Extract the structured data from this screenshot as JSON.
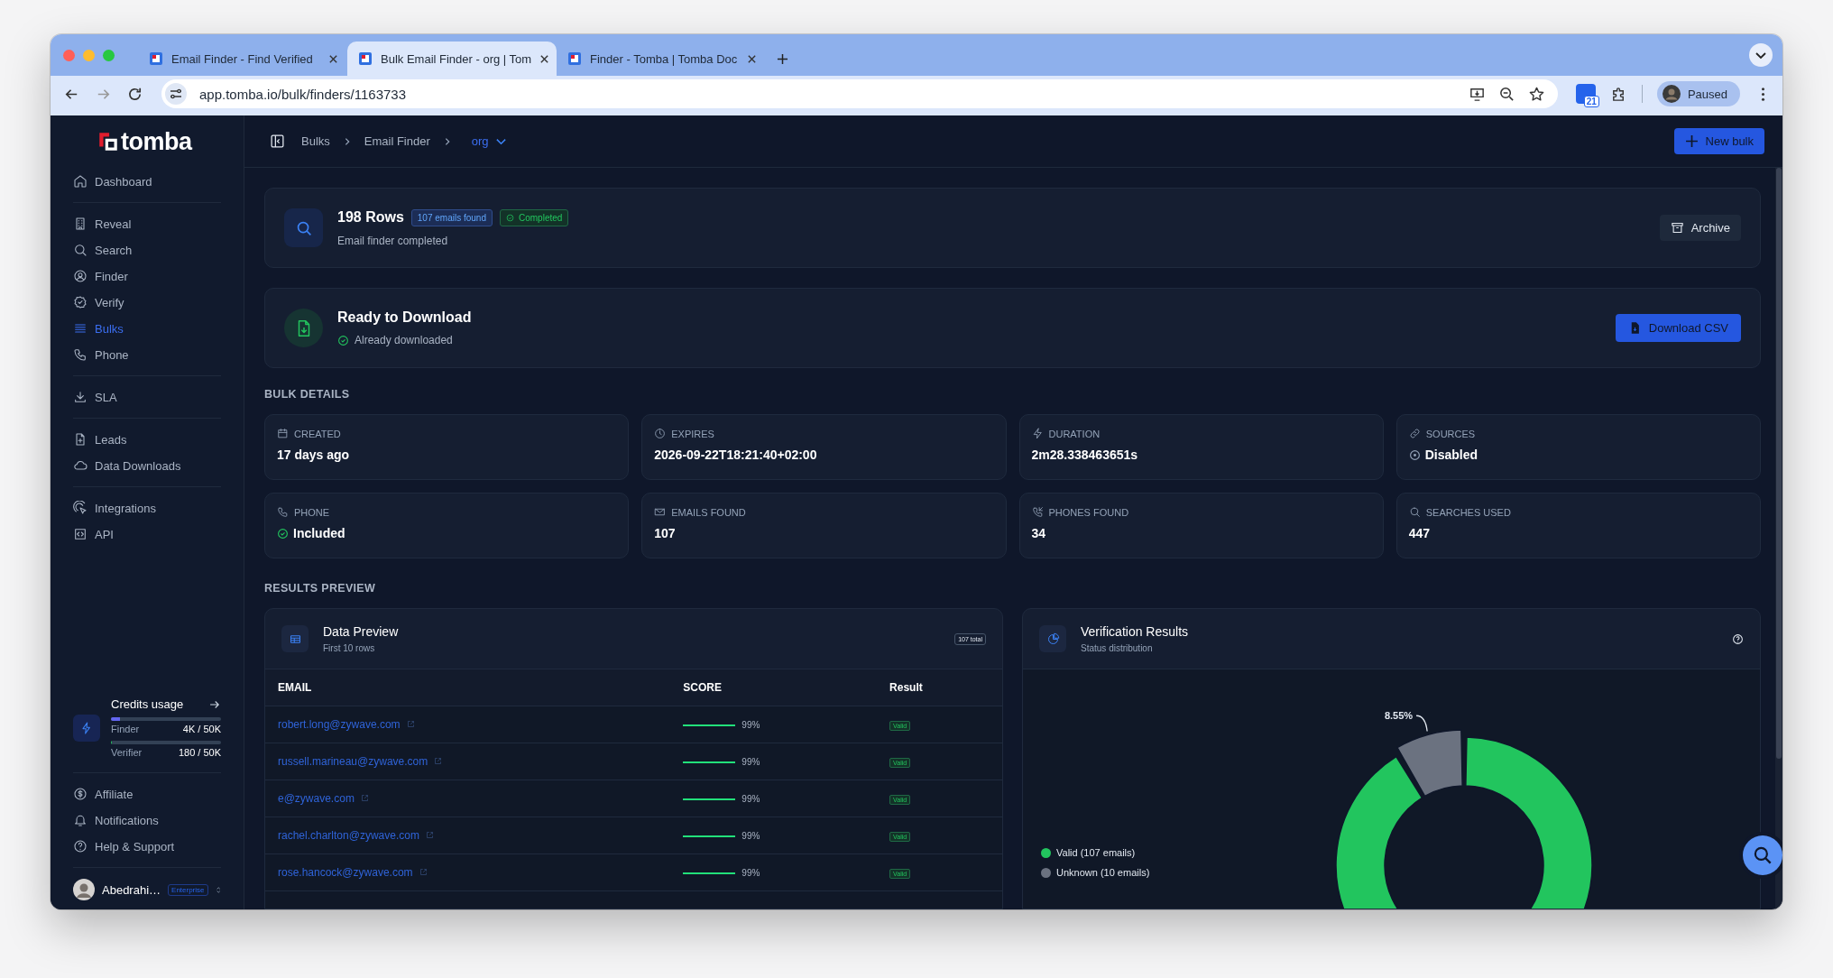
{
  "browser": {
    "tabs": [
      {
        "title": "Email Finder - Find Verified",
        "selected": false
      },
      {
        "title": "Bulk Email Finder - org | Tom",
        "selected": true
      },
      {
        "title": "Finder - Tomba | Tomba Doc",
        "selected": false
      }
    ],
    "url": "app.tomba.io/bulk/finders/1163733",
    "extension_badge": "21",
    "profile": "Paused"
  },
  "sidebar": {
    "logo": "tomba",
    "groups": [
      {
        "items": [
          {
            "label": "Dashboard",
            "selected": false
          }
        ]
      },
      {
        "items": [
          {
            "label": "Reveal",
            "selected": false
          },
          {
            "label": "Search",
            "selected": false
          },
          {
            "label": "Finder",
            "selected": false
          },
          {
            "label": "Verify",
            "selected": false
          },
          {
            "label": "Bulks",
            "selected": true
          },
          {
            "label": "Phone",
            "selected": false
          }
        ]
      },
      {
        "items": [
          {
            "label": "SLA",
            "selected": false
          }
        ]
      },
      {
        "items": [
          {
            "label": "Leads",
            "selected": false
          },
          {
            "label": "Data Downloads",
            "selected": false
          }
        ]
      },
      {
        "items": [
          {
            "label": "Integrations",
            "selected": false
          },
          {
            "label": "API",
            "selected": false
          }
        ]
      }
    ],
    "credits": {
      "title": "Credits usage",
      "meters": [
        {
          "label": "Finder",
          "reading": "4K / 50K",
          "level": 0.08
        },
        {
          "label": "Verifier",
          "reading": "180 / 50K",
          "level": 0.004
        }
      ]
    },
    "footer_items": [
      {
        "label": "Affiliate",
        "selected": false
      },
      {
        "label": "Notifications",
        "selected": false
      },
      {
        "label": "Help & Support",
        "selected": false
      }
    ],
    "user": {
      "name": "Abedrahi…",
      "plan": "Enterprise"
    }
  },
  "breadcrumb": [
    "Bulks",
    "Email Finder",
    "org"
  ],
  "new_bulk": "New bulk",
  "summary": {
    "title": "198 Rows",
    "badges": [
      {
        "label": "107 emails found",
        "kind": "info"
      },
      {
        "label": "Completed",
        "kind": "success"
      }
    ],
    "subtitle": "Email finder completed",
    "action": "Archive"
  },
  "download": {
    "title": "Ready to Download",
    "status": "Already downloaded",
    "action": "Download CSV"
  },
  "details": {
    "heading": "BULK DETAILS",
    "items": [
      {
        "label": "CREATED",
        "value": "17 days ago"
      },
      {
        "label": "EXPIRES",
        "value": "2026-09-22T18:21:40+02:00"
      },
      {
        "label": "DURATION",
        "value": "2m28.338463651s"
      },
      {
        "label": "SOURCES",
        "value": "Disabled",
        "on": false
      },
      {
        "label": "PHONE",
        "value": "Included",
        "on": true
      },
      {
        "label": "EMAILS FOUND",
        "value": "107"
      },
      {
        "label": "PHONES FOUND",
        "value": "34"
      },
      {
        "label": "SEARCHES USED",
        "value": "447"
      }
    ]
  },
  "results": {
    "heading": "RESULTS PREVIEW",
    "preview": {
      "title": "Data Preview",
      "subtitle": "First 10 rows",
      "badge": "107 total",
      "columns": [
        "EMAIL",
        "SCORE",
        "Result"
      ],
      "rows": [
        {
          "email": "robert.long@zywave.com",
          "level": 0.99,
          "score": "99%",
          "result": "Valid"
        },
        {
          "email": "russell.marineau@zywave.com",
          "level": 0.99,
          "score": "99%",
          "result": "Valid"
        },
        {
          "email": "e@zywave.com",
          "level": 0.99,
          "score": "99%",
          "result": "Valid"
        },
        {
          "email": "rachel.charlton@zywave.com",
          "level": 0.99,
          "score": "99%",
          "result": "Valid"
        },
        {
          "email": "rose.hancock@zywave.com",
          "level": 0.99,
          "score": "99%",
          "result": "Valid"
        }
      ]
    },
    "verification": {
      "title": "Verification Results",
      "subtitle": "Status distribution",
      "legend": [
        {
          "color": "#22c55e"
        },
        {
          "color": "#6b7280"
        }
      ],
      "chart_data": {
        "type": "donut",
        "categories": [
          "Valid (107 emails)",
          "Unknown (10 emails)"
        ],
        "values": [
          91.45,
          8.55
        ],
        "value_labels": [
          null,
          "8.55%"
        ]
      }
    }
  }
}
